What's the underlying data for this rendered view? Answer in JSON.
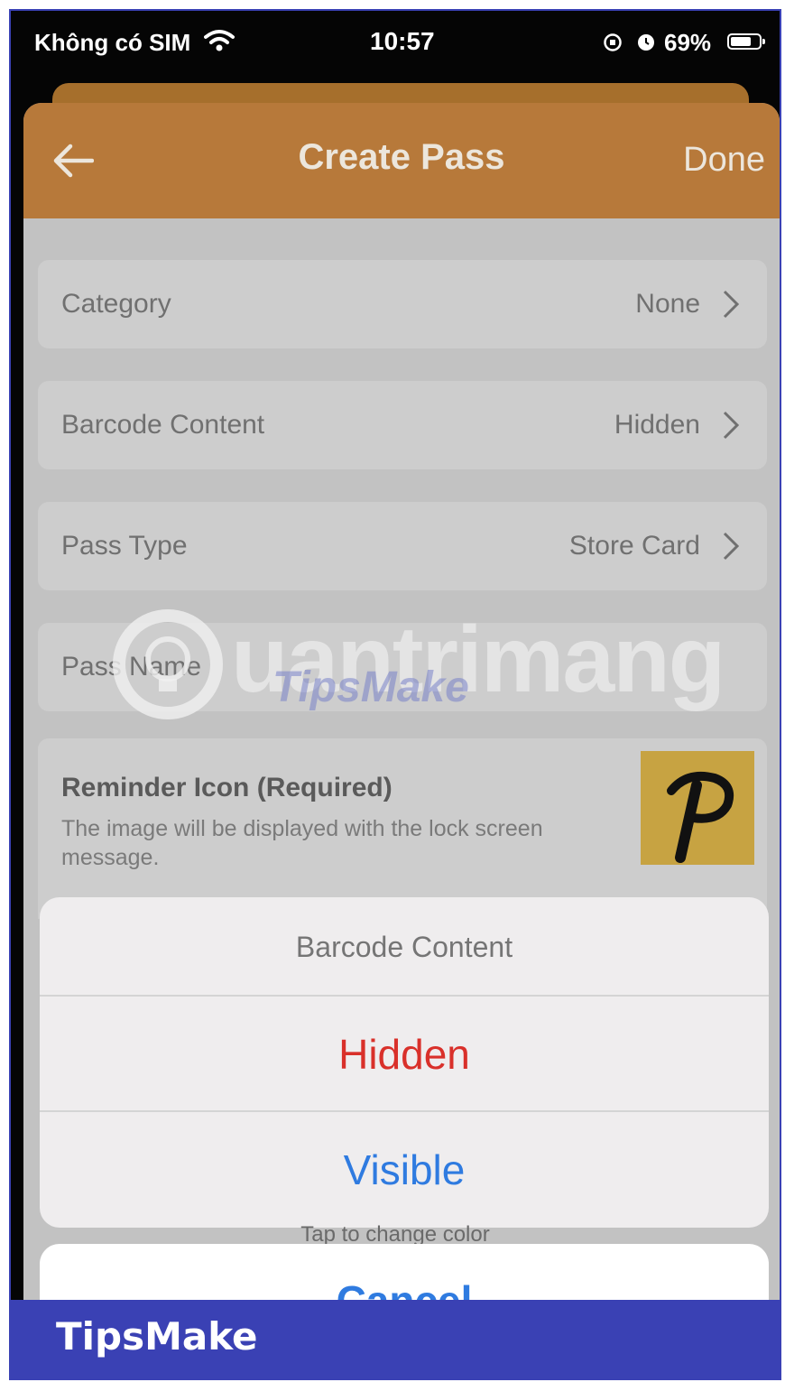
{
  "status_bar": {
    "carrier": "Không có SIM",
    "time": "10:57",
    "battery": "69%"
  },
  "nav": {
    "title": "Create Pass",
    "done_label": "Done"
  },
  "rows": [
    {
      "label": "Category",
      "value": "None"
    },
    {
      "label": "Barcode Content",
      "value": "Hidden"
    },
    {
      "label": "Pass Type",
      "value": "Store Card"
    },
    {
      "label": "Pass Name",
      "value": ""
    }
  ],
  "reminder": {
    "title": "Reminder Icon (Required)",
    "description": "The image will be displayed with the lock screen message.",
    "icon_letter": "P"
  },
  "watermark": {
    "text": "uantrimang",
    "sub": "TipsMake"
  },
  "action_sheet": {
    "title": "Barcode Content",
    "options": [
      {
        "label": "Hidden",
        "color": "#d9302a"
      },
      {
        "label": "Visible",
        "color": "#2f7be0"
      }
    ],
    "cancel_label": "Cancel",
    "hint": "Tap to change color"
  },
  "branding": {
    "label": "TipsMake"
  },
  "colors": {
    "nav_accent": "#b7793a",
    "frame": "#3a41b4",
    "destructive": "#d9302a",
    "link": "#2f7be0"
  }
}
